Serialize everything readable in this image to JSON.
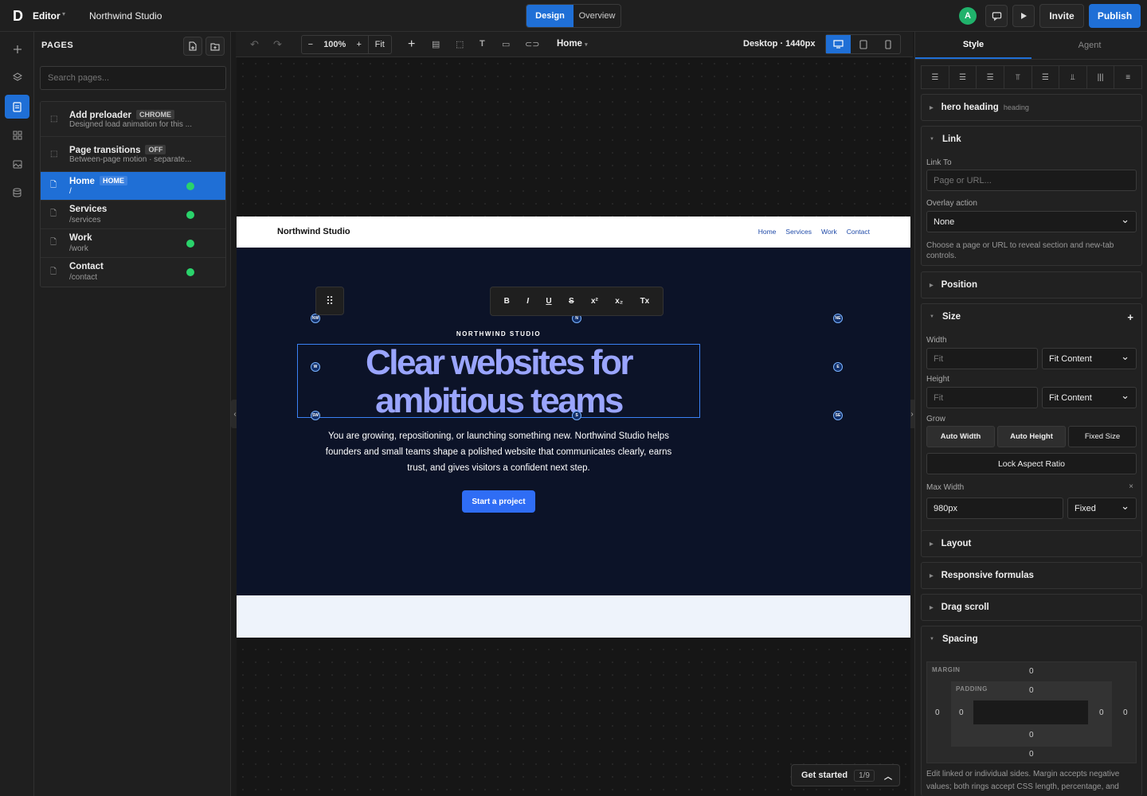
{
  "topbar": {
    "logo": "D",
    "editor_label": "Editor",
    "project_name": "Northwind Studio",
    "mode_tabs": [
      "Design",
      "Overview"
    ],
    "avatar_initial": "A",
    "invite_label": "Invite",
    "publish_label": "Publish"
  },
  "pages_panel": {
    "title": "PAGES",
    "search_placeholder": "Search pages...",
    "items": [
      {
        "title": "Add preloader",
        "badge": "CHROME",
        "subtitle": "Designed load animation for this ..."
      },
      {
        "title": "Page transitions",
        "badge": "OFF",
        "subtitle": "Between-page motion · separate..."
      },
      {
        "title": "Home",
        "badge": "HOME",
        "subtitle": "/"
      },
      {
        "title": "Services",
        "subtitle": "/services"
      },
      {
        "title": "Work",
        "subtitle": "/work"
      },
      {
        "title": "Contact",
        "subtitle": "/contact"
      }
    ]
  },
  "canvas_toolbar": {
    "zoom": "100%",
    "fit_label": "Fit",
    "page_select": "Home",
    "breakpoint_label": "Desktop · 1440px"
  },
  "site": {
    "brand": "Northwind Studio",
    "nav_links": [
      "Home",
      "Services",
      "Work",
      "Contact"
    ],
    "eyebrow": "NORTHWIND STUDIO",
    "headline_line1": "Clear websites for",
    "headline_line2": "ambitious teams",
    "paragraph_line1": "You are growing, repositioning, or launching something new. Northwind Studio helps",
    "paragraph_line2": "founders and small teams shape a polished website that communicates clearly, earns",
    "paragraph_line3": "trust, and gives visitors a confident next step.",
    "cta": "Start a project",
    "handle_labels": [
      "NW",
      "N",
      "NE",
      "W",
      "E",
      "SW",
      "S",
      "SE"
    ]
  },
  "format_toolbar": [
    "B",
    "I",
    "U",
    "S",
    "x²",
    "x₂",
    "Tx"
  ],
  "get_started": {
    "label": "Get started",
    "count": "1/9"
  },
  "inspector": {
    "tabs": [
      "Style",
      "Agent"
    ],
    "element": {
      "name": "hero heading",
      "type": "heading"
    },
    "link": {
      "title": "Link",
      "link_to_label": "Link To",
      "link_to_placeholder": "Page or URL...",
      "overlay_label": "Overlay action",
      "overlay_value": "None",
      "help": "Choose a page or URL to reveal section and new-tab controls."
    },
    "position_title": "Position",
    "size": {
      "title": "Size",
      "width_label": "Width",
      "width_placeholder": "Fit",
      "width_mode": "Fit Content",
      "height_label": "Height",
      "height_placeholder": "Fit",
      "height_mode": "Fit Content",
      "grow_label": "Grow",
      "grow_options": [
        "Auto Width",
        "Auto Height",
        "Fixed Size"
      ],
      "lock_label": "Lock Aspect Ratio",
      "max_width_label": "Max Width",
      "max_width_value": "980px",
      "max_width_mode": "Fixed"
    },
    "sections": [
      "Layout",
      "Responsive formulas",
      "Drag scroll"
    ],
    "spacing": {
      "title": "Spacing",
      "margin_label": "MARGIN",
      "padding_label": "PADDING",
      "values": [
        "0",
        "0",
        "0",
        "0",
        "0",
        "0",
        "0",
        "0"
      ],
      "help": "Edit linked or individual sides. Margin accepts negative values; both rings accept CSS length, percentage, and"
    }
  },
  "colors": {
    "accent": "#1f6fd6",
    "headline": "#9aa5ff",
    "hero_bg": "#0c1328",
    "status": "#2ad36b"
  }
}
